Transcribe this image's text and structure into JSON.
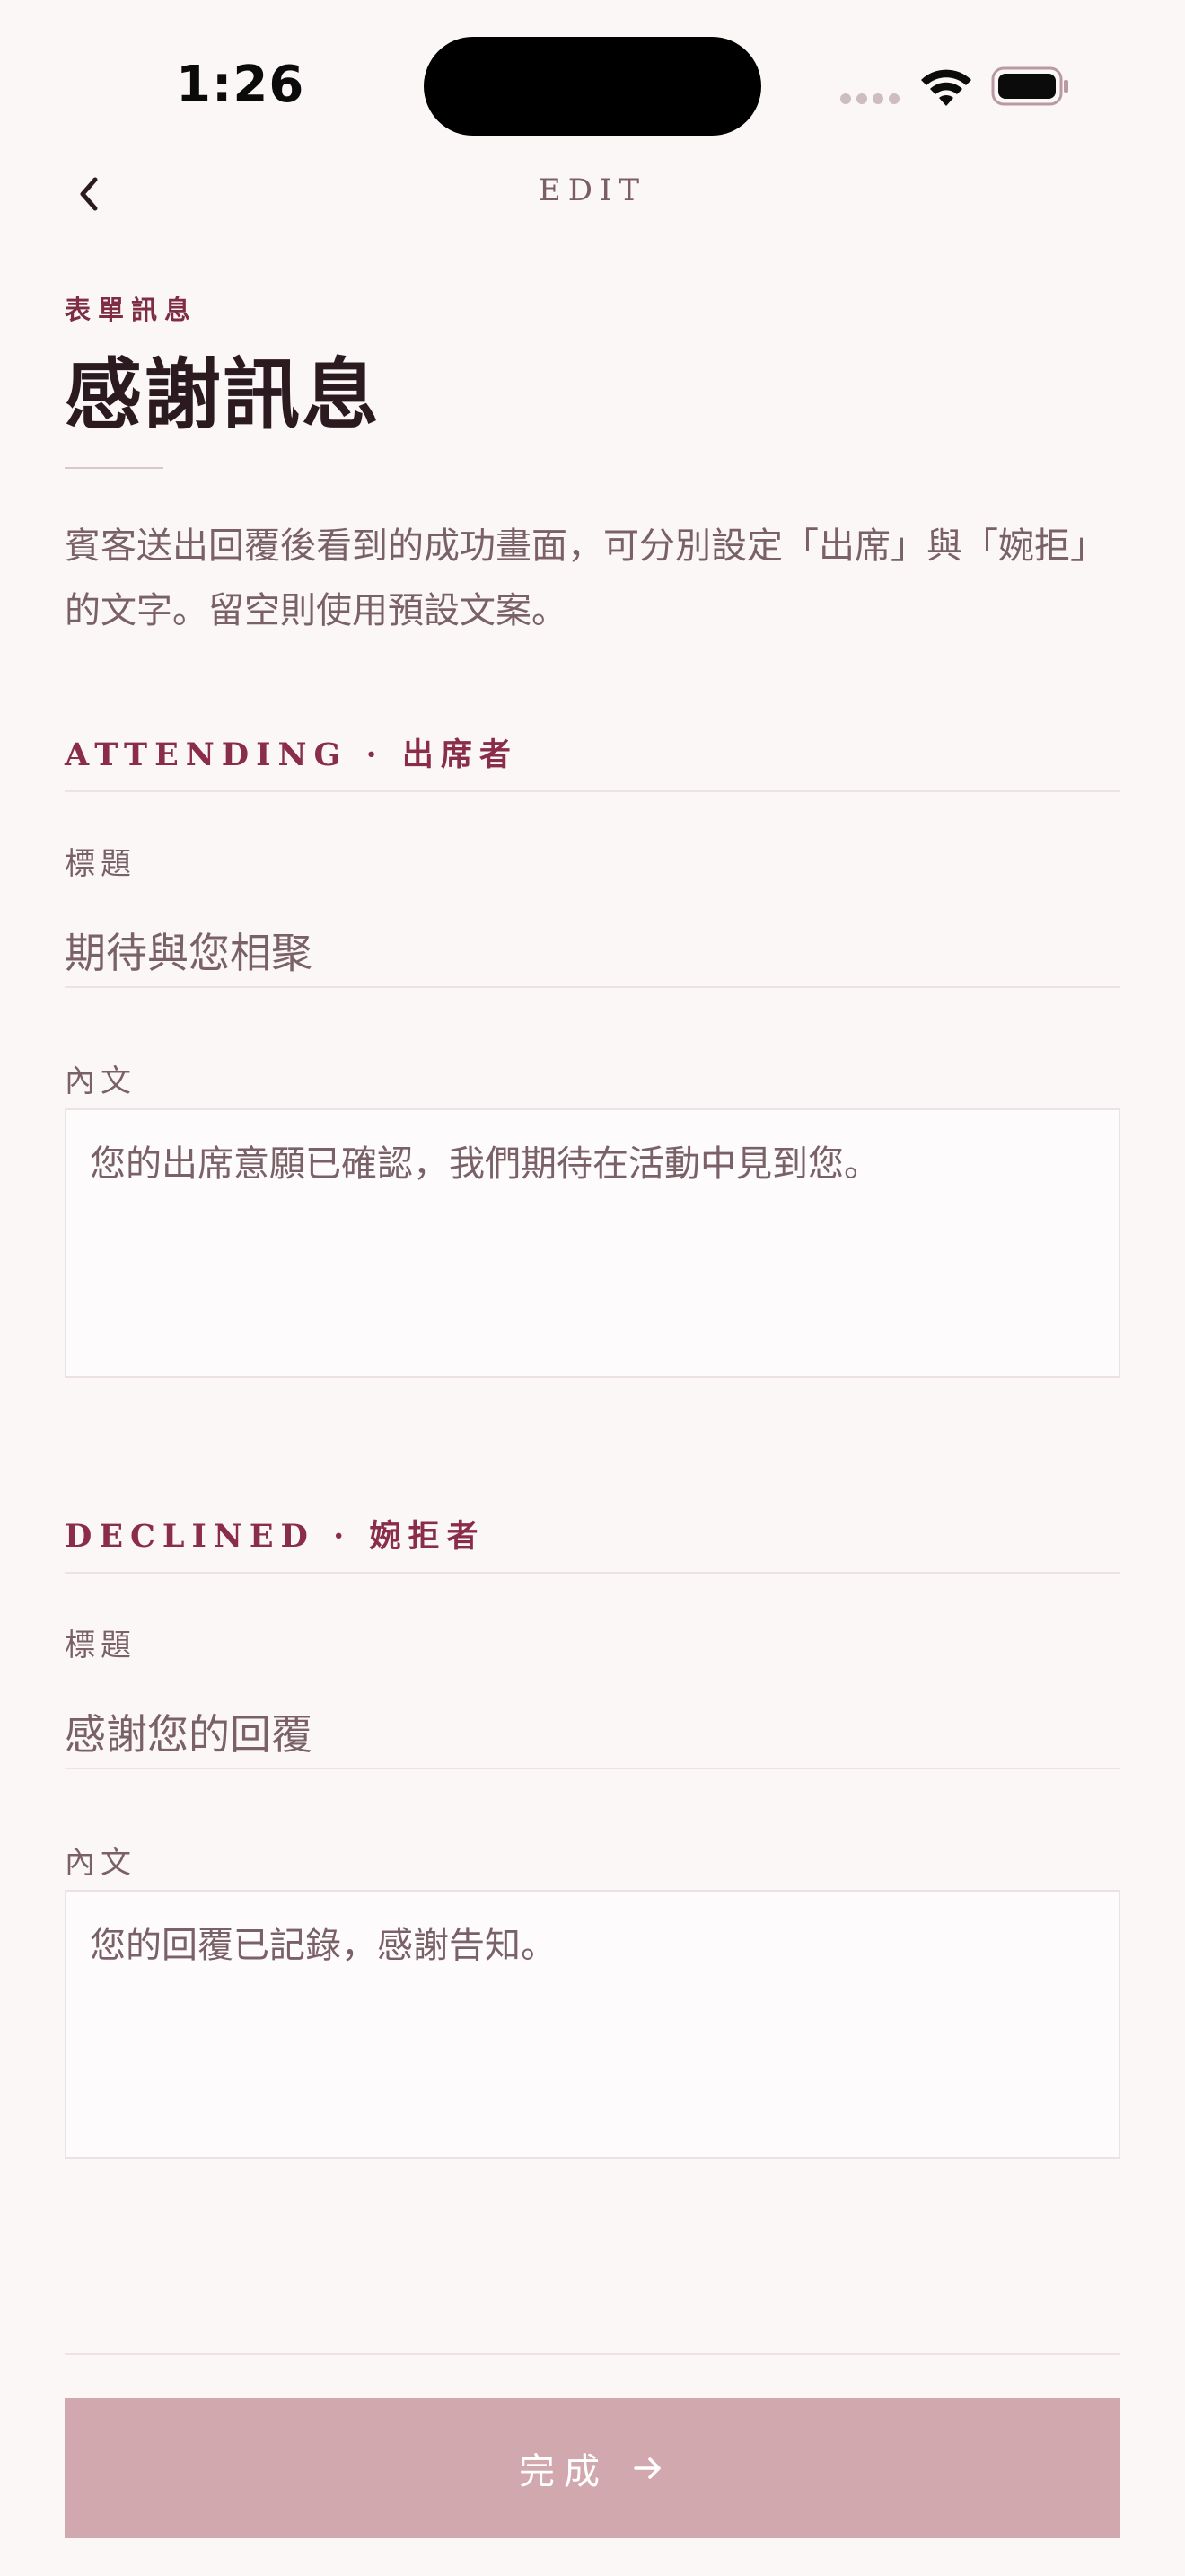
{
  "status_bar": {
    "time": "1:26"
  },
  "nav": {
    "title": "EDIT"
  },
  "header": {
    "eyebrow": "表單訊息",
    "title": "感謝訊息",
    "description": "賓客送出回覆後看到的成功畫面，可分別設定「出席」與「婉拒」的文字。留空則使用預設文案。"
  },
  "attending": {
    "section_label": "ATTENDING · 出席者",
    "title_label": "標題",
    "title_value": "期待與您相聚",
    "body_label": "內文",
    "body_value": "您的出席意願已確認，我們期待在活動中見到您。"
  },
  "declined": {
    "section_label": "DECLINED · 婉拒者",
    "title_label": "標題",
    "title_value": "感謝您的回覆",
    "body_label": "內文",
    "body_value": "您的回覆已記錄，感謝告知。"
  },
  "footer": {
    "done_label": "完成"
  },
  "icons": {
    "back": "chevron-left-icon",
    "done": "arrow-right-icon",
    "wifi": "wifi-icon",
    "battery": "battery-icon",
    "signal": "signal-icon"
  },
  "colors": {
    "background": "#fbf7f6",
    "accent": "#8a2d4a",
    "button": "#d1a8ad",
    "muted_text": "#7a6168"
  }
}
